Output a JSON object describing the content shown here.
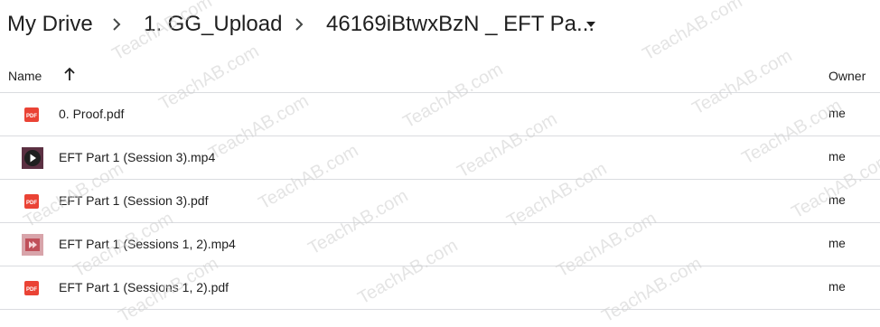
{
  "breadcrumb": {
    "items": [
      "My Drive",
      "1. GG_Upload",
      "46169iBtwxBzN _ EFT Pa..."
    ]
  },
  "columns": {
    "name": "Name",
    "owner": "Owner"
  },
  "files": [
    {
      "name": "0. Proof.pdf",
      "owner": "me",
      "type": "pdf-icon"
    },
    {
      "name": "EFT Part 1 (Session 3).mp4",
      "owner": "me",
      "type": "video-thumbnail-icon"
    },
    {
      "name": "EFT Part 1 (Session 3).pdf",
      "owner": "me",
      "type": "pdf-icon"
    },
    {
      "name": "EFT Part 1 (Sessions 1, 2).mp4",
      "owner": "me",
      "type": "video-thumbnail-icon"
    },
    {
      "name": "EFT Part 1 (Sessions 1, 2).pdf",
      "owner": "me",
      "type": "pdf-icon"
    }
  ],
  "watermark": "TeachAB.com",
  "colors": {
    "pdf_red": "#ea4335",
    "divider": "#dadce0",
    "text": "#1f1f1f"
  }
}
